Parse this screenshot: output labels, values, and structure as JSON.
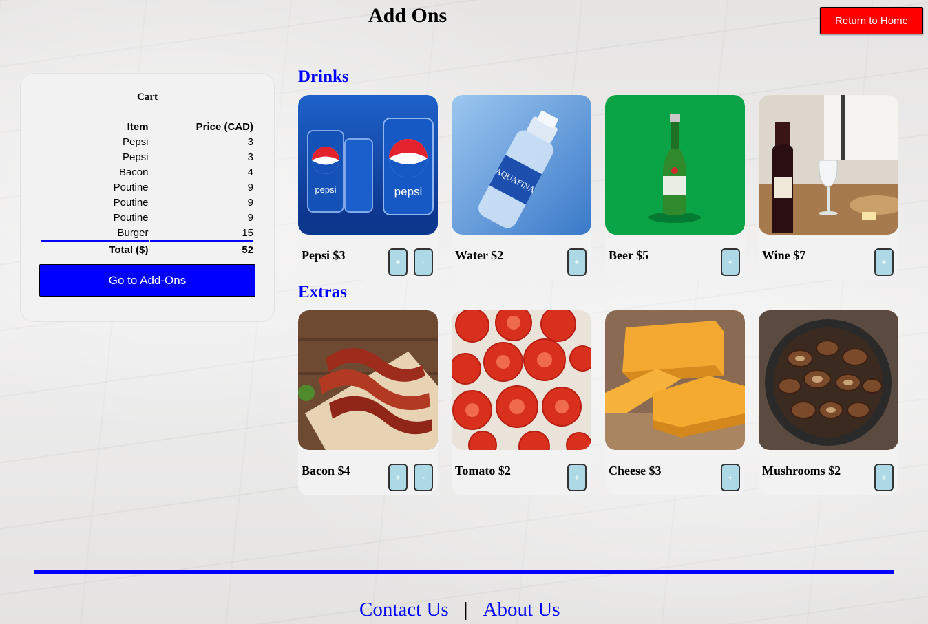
{
  "page": {
    "title": "Add Ons"
  },
  "header": {
    "return_home_label": "Return to Home"
  },
  "cart": {
    "title": "Cart",
    "headers": {
      "item": "Item",
      "price": "Price (CAD)"
    },
    "rows": [
      {
        "item": "Pepsi",
        "price": "3"
      },
      {
        "item": "Pepsi",
        "price": "3"
      },
      {
        "item": "Bacon",
        "price": "4"
      },
      {
        "item": "Poutine",
        "price": "9"
      },
      {
        "item": "Poutine",
        "price": "9"
      },
      {
        "item": "Poutine",
        "price": "9"
      },
      {
        "item": "Burger",
        "price": "15"
      }
    ],
    "total_label": "Total ($)",
    "total_value": "52",
    "addons_button_label": "Go to Add-Ons"
  },
  "sections": {
    "drinks": {
      "heading": "Drinks",
      "items": [
        {
          "label": "Pepsi $3",
          "image": "pepsi-cans-image",
          "plus": "+",
          "minus": "-"
        },
        {
          "label": "Water $2",
          "image": "water-bottle-image",
          "plus": "+"
        },
        {
          "label": "Beer $5",
          "image": "beer-bottle-image",
          "plus": "+"
        },
        {
          "label": "Wine $7",
          "image": "wine-bottle-image",
          "plus": "+"
        }
      ]
    },
    "extras": {
      "heading": "Extras",
      "items": [
        {
          "label": "Bacon $4",
          "image": "bacon-image",
          "plus": "+",
          "minus": "-"
        },
        {
          "label": "Tomato $2",
          "image": "tomato-slices-image",
          "plus": "+"
        },
        {
          "label": "Cheese $3",
          "image": "cheese-blocks-image",
          "plus": "+"
        },
        {
          "label": "Mushrooms $2",
          "image": "mushrooms-pan-image",
          "plus": "+"
        }
      ]
    }
  },
  "footer": {
    "contact_label": "Contact Us",
    "separator": "|",
    "about_label": "About Us"
  },
  "colors": {
    "accent_blue": "#0000ff",
    "home_red": "#ff0000",
    "qty_button": "#add8e6",
    "card_bg": "#f2f2f2"
  }
}
